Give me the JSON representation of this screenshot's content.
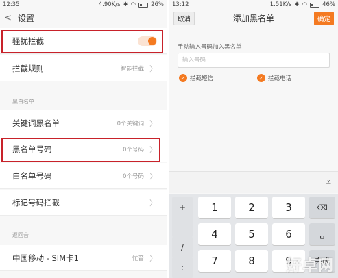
{
  "left": {
    "status": {
      "time": "12:35",
      "speed": "4.90K/s",
      "battery": "26%"
    },
    "header": {
      "title": "设置"
    },
    "harass": {
      "label": "骚扰拦截"
    },
    "rules": {
      "label": "拦截规则",
      "value": "智能拦截"
    },
    "section_bw": "黑白名单",
    "keyword": {
      "label": "关键词黑名单",
      "value": "0个关键词"
    },
    "blacklist": {
      "label": "黑名单号码",
      "value": "0个号码"
    },
    "whitelist": {
      "label": "白名单号码",
      "value": "0个号码"
    },
    "marked": {
      "label": "标记号码拦截"
    },
    "section_return": "返回音",
    "sim": {
      "label": "中国移动 - SIM卡1",
      "value": "忙音"
    }
  },
  "right": {
    "status": {
      "time": "13:12",
      "speed": "1.51K/s",
      "battery": "46%"
    },
    "header": {
      "cancel": "取消",
      "title": "添加黑名单",
      "ok": "确定"
    },
    "hint": "手动输入号码加入黑名单",
    "input_placeholder": "输入号码",
    "check_sms": "拦截短信",
    "check_call": "拦截电话",
    "keyboard": {
      "symbols": [
        "+",
        "-",
        "/",
        ":"
      ],
      "digits": [
        "1",
        "2",
        "3",
        "4",
        "5",
        "6",
        "7",
        "8",
        "9"
      ],
      "done": "完成"
    }
  },
  "watermark": "好卓网",
  "colors": {
    "accent": "#f47a21",
    "highlight": "#c8222a"
  }
}
